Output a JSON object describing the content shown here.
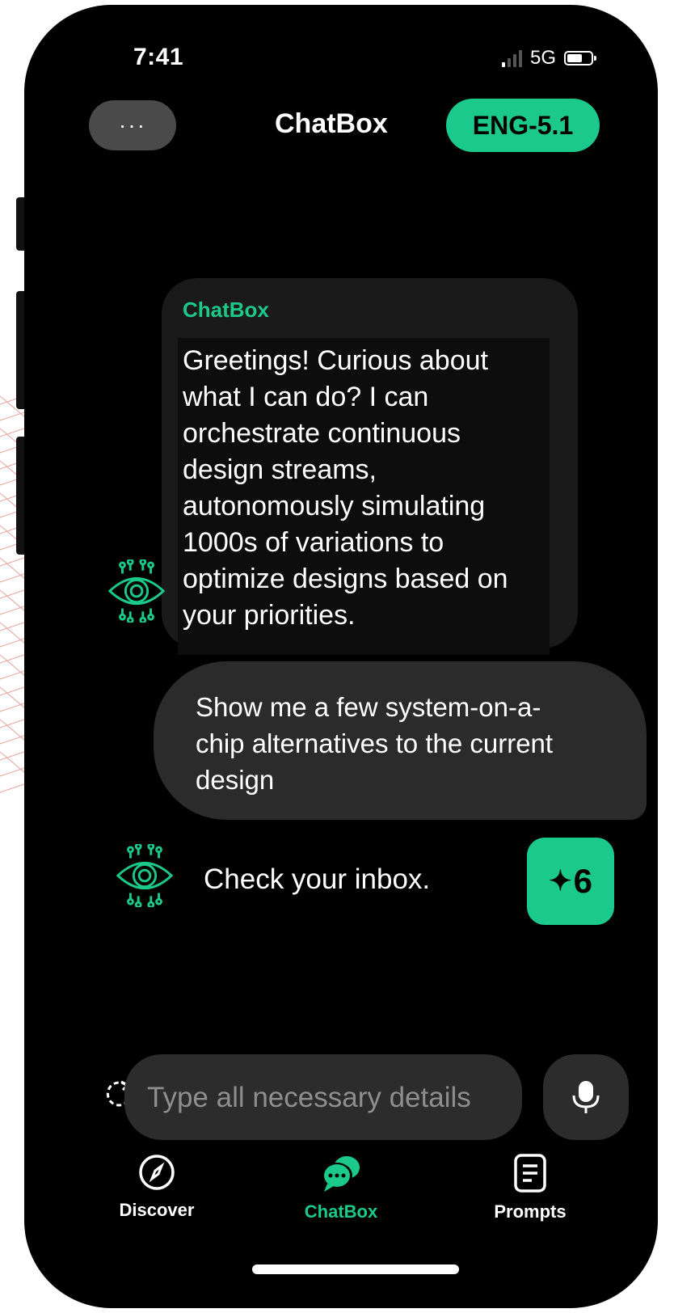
{
  "status_bar": {
    "time": "7:41",
    "network": "5G"
  },
  "header": {
    "menu_label": "···",
    "title": "ChatBox",
    "model_badge": "ENG-5.1"
  },
  "messages": [
    {
      "role": "bot",
      "sender": "ChatBox",
      "text": "Greetings! Curious about what I can do? I can orchestrate continuous design streams, autonomously simulating 1000s of variations to optimize designs based on your priorities."
    },
    {
      "role": "user",
      "text": "Show me a few system-on-a-chip alternatives to the current design"
    },
    {
      "role": "bot",
      "text": "Check your inbox."
    }
  ],
  "spark_button": {
    "icon": "sparkle-icon",
    "count": "6"
  },
  "composer": {
    "placeholder": "Type all necessary details"
  },
  "tabbar": {
    "items": [
      {
        "label": "Discover",
        "icon": "compass-icon",
        "active": false
      },
      {
        "label": "ChatBox",
        "icon": "chat-bubbles-icon",
        "active": true
      },
      {
        "label": "Prompts",
        "icon": "document-icon",
        "active": false
      }
    ]
  },
  "colors": {
    "accent": "#1ac98b",
    "background": "#000000",
    "bubble": "#2b2b2b",
    "inactive_tab": "#ffffff"
  }
}
